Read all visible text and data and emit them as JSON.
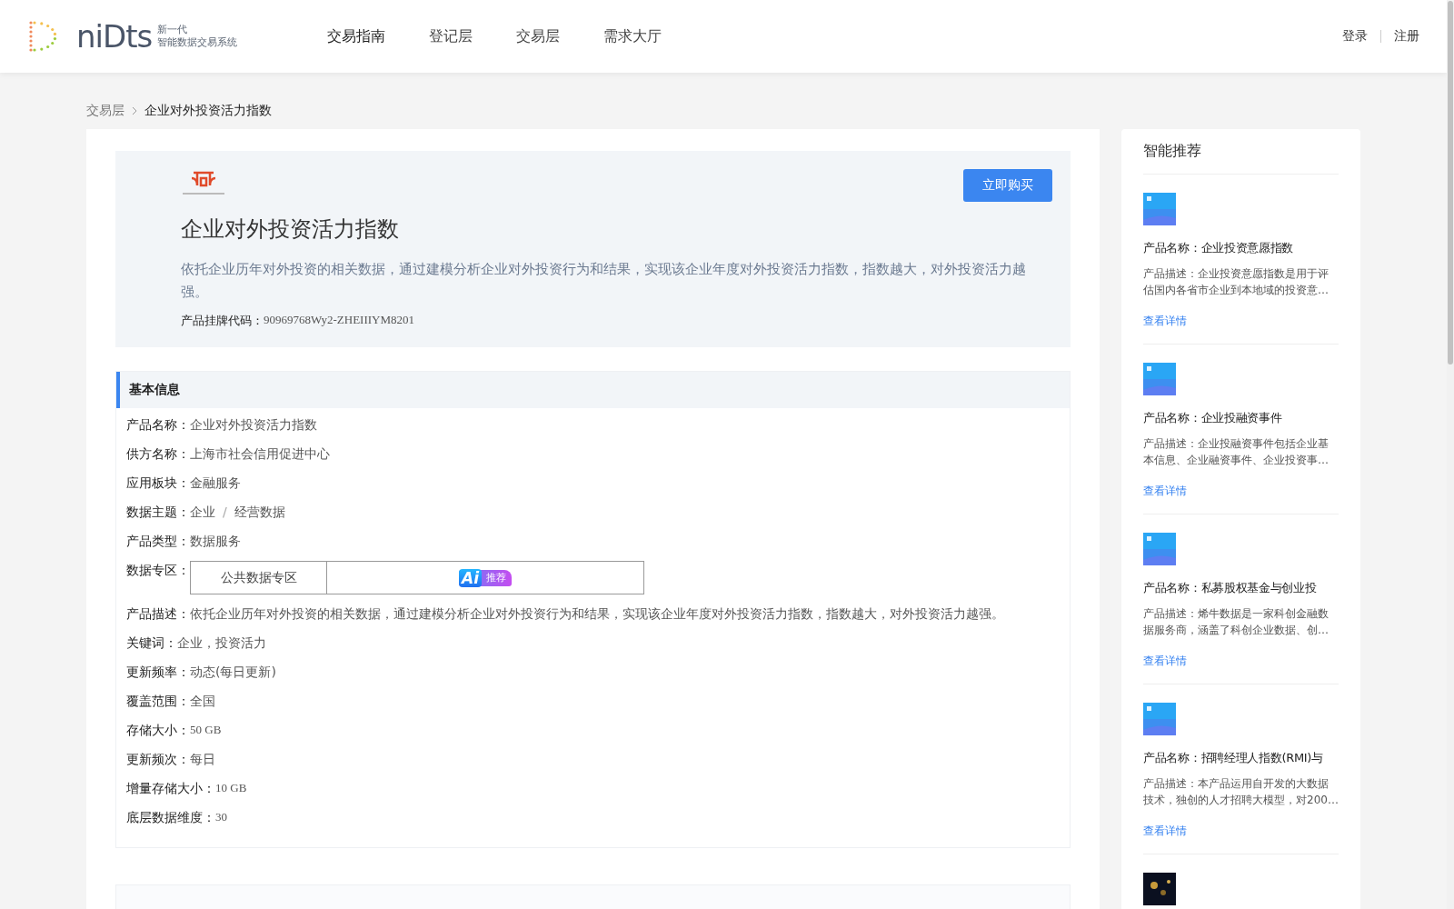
{
  "header": {
    "logo": {
      "wordmark": "niDts",
      "tagline_top": "新一代",
      "tagline_bottom": "智能数据交易系统"
    },
    "nav": [
      {
        "label": "交易指南",
        "selected": true
      },
      {
        "label": "登记层",
        "selected": false
      },
      {
        "label": "交易层",
        "selected": false
      },
      {
        "label": "需求大厅",
        "selected": false
      }
    ],
    "auth": [
      "登录",
      "注册"
    ]
  },
  "breadcrumb": [
    "交易层",
    "企业对外投资活力指数"
  ],
  "product": {
    "title": "企业对外投资活力指数",
    "description": "依托企业历年对外投资的相关数据，通过建模分析企业对外投资行为和结果，实现该企业年度对外投资活力指数，指数越大，对外投资活力越强。",
    "code_label": "产品挂牌代码：",
    "code": "90969768Wy2-ZHEIIIYM8201",
    "buy_button": "立即购买"
  },
  "basic_info": {
    "title": "基本信息",
    "rows": [
      {
        "kind": "text",
        "label": "产品名称：",
        "value": "企业对外投资活力指数"
      },
      {
        "kind": "text",
        "label": "供方名称：",
        "value": "上海市社会信用促进中心"
      },
      {
        "kind": "text",
        "label": "应用板块：",
        "value": "金融服务"
      },
      {
        "kind": "path",
        "label": "数据主题：",
        "parts": [
          "企业",
          "/",
          "经营数据"
        ]
      },
      {
        "kind": "text",
        "label": "产品类型：",
        "value": "数据服务"
      },
      {
        "kind": "zone",
        "label": "数据专区：",
        "zone": "公共数据专区",
        "badge_mark": "Ai",
        "badge_text": "推荐"
      },
      {
        "kind": "text",
        "label": "产品描述：",
        "value": "依托企业历年对外投资的相关数据，通过建模分析企业对外投资行为和结果，实现该企业年度对外投资活力指数，指数越大，对外投资活力越强。"
      },
      {
        "kind": "text",
        "label": "关键词：",
        "value": "企业，投资活力"
      },
      {
        "kind": "text",
        "label": "更新频率：",
        "value": "动态(每日更新)"
      },
      {
        "kind": "text",
        "label": "覆盖范围：",
        "value": "全国"
      },
      {
        "kind": "number",
        "label": "存储大小：",
        "value": "50 GB"
      },
      {
        "kind": "text",
        "label": "更新频次：",
        "value": "每日"
      },
      {
        "kind": "number",
        "label": "增量存储大小：",
        "value": "10 GB"
      },
      {
        "kind": "number",
        "label": "底层数据维度：",
        "value": "30"
      }
    ]
  },
  "recommendations": {
    "title": "智能推荐",
    "items": [
      {
        "name": "产品名称：企业投资意愿指数",
        "description": "产品描述：企业投资意愿指数是用于评估国内各省市企业到本地域的投资意…",
        "link": "查看详情",
        "kind": "picture"
      },
      {
        "name": "产品名称：企业投融资事件",
        "description": "产品描述：企业投融资事件包括企业基本信息、企业融资事件、企业投资事…",
        "link": "查看详情",
        "kind": "picture"
      },
      {
        "name": "产品名称：私募股权基金与创业投",
        "description": "产品描述：烯牛数据是一家科创金融数据服务商，涵盖了科创企业数据、创…",
        "link": "查看详情",
        "kind": "picture"
      },
      {
        "name": "产品名称：招聘经理人指数(RMI)与",
        "description": "产品描述：本产品运用自开发的大数据技术，独创的人才招聘大模型，对200…",
        "link": "查看详情",
        "kind": "picture"
      },
      {
        "kind": "picture"
      }
    ]
  }
}
